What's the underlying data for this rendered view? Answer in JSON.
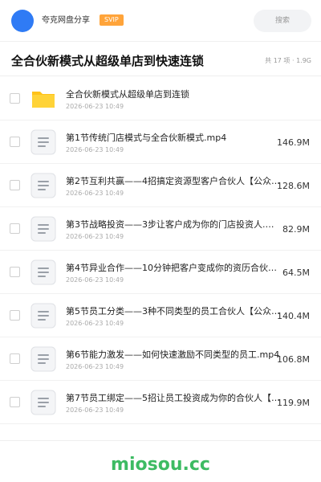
{
  "header": {
    "owner_name": "夸克网盘分享",
    "badge": "SVIP",
    "search_label": "搜索",
    "accent_color": "#2f7bf5",
    "badge_color": "#ffa43a"
  },
  "share": {
    "title": "全合伙新模式从超级单店到快速连锁",
    "meta": "共 17 项 · 1.9G"
  },
  "files": [
    {
      "type": "folder",
      "icon": "folder-icon",
      "name": "全合伙新模式从超级单店到连锁",
      "date": "2026-06-23 10:49",
      "size": ""
    },
    {
      "type": "file",
      "icon": "document-icon",
      "name": "第1节传统门店模式与全合伙新模式.mp4",
      "date": "2026-06-23 10:49",
      "size": "146.9M"
    },
    {
      "type": "file",
      "icon": "document-icon",
      "name": "第2节互利共赢——4招搞定资源型客户合伙人【公众号·",
      "date": "2026-06-23 10:49",
      "size": "128.6M"
    },
    {
      "type": "file",
      "icon": "document-icon",
      "name": "第3节战略投资——3步让客户成为你的门店投资人.m···",
      "date": "2026-06-23 10:49",
      "size": "82.9M"
    },
    {
      "type": "file",
      "icon": "document-icon",
      "name": "第4节异业合作——10分钟把客户变成你的资历合伙人···",
      "date": "2026-06-23 10:49",
      "size": "64.5M"
    },
    {
      "type": "file",
      "icon": "document-icon",
      "name": "第5节员工分类——3种不同类型的员工合伙人【公众号·",
      "date": "2026-06-23 10:49",
      "size": "140.4M"
    },
    {
      "type": "file",
      "icon": "document-icon",
      "name": "第6节能力激发——如何快速激励不同类型的员工.mp4",
      "date": "2026-06-23 10:49",
      "size": "106.8M"
    },
    {
      "type": "file",
      "icon": "document-icon",
      "name": "第7节员工绑定——5招让员工投资成为你的合伙人【公·",
      "date": "2026-06-23 10:49",
      "size": "119.9M"
    }
  ],
  "watermark": "miosou.cc"
}
